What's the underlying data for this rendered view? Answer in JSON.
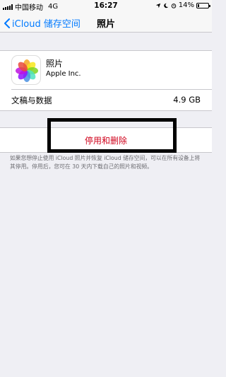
{
  "status_bar": {
    "carrier": "中国移动",
    "network": "4G",
    "time": "16:27",
    "battery_percent": "14%",
    "battery_level": 0.14
  },
  "nav": {
    "back_label": "iCloud 储存空间",
    "title": "照片"
  },
  "app": {
    "name": "照片",
    "vendor": "Apple Inc.",
    "icon": "photos-app-icon"
  },
  "docs": {
    "label": "文稿与数据",
    "value": "4.9 GB"
  },
  "action": {
    "disable_label": "停用和删除"
  },
  "footer": {
    "text": "如果您想停止使用 iCloud 照片并恢复 iCloud 储存空间，可以在所有设备上将其停用。停用后，您可在 30 天内下载自己的照片和视频。"
  },
  "colors": {
    "accent": "#007aff",
    "destructive": "#d0021b",
    "background": "#efeff4"
  }
}
